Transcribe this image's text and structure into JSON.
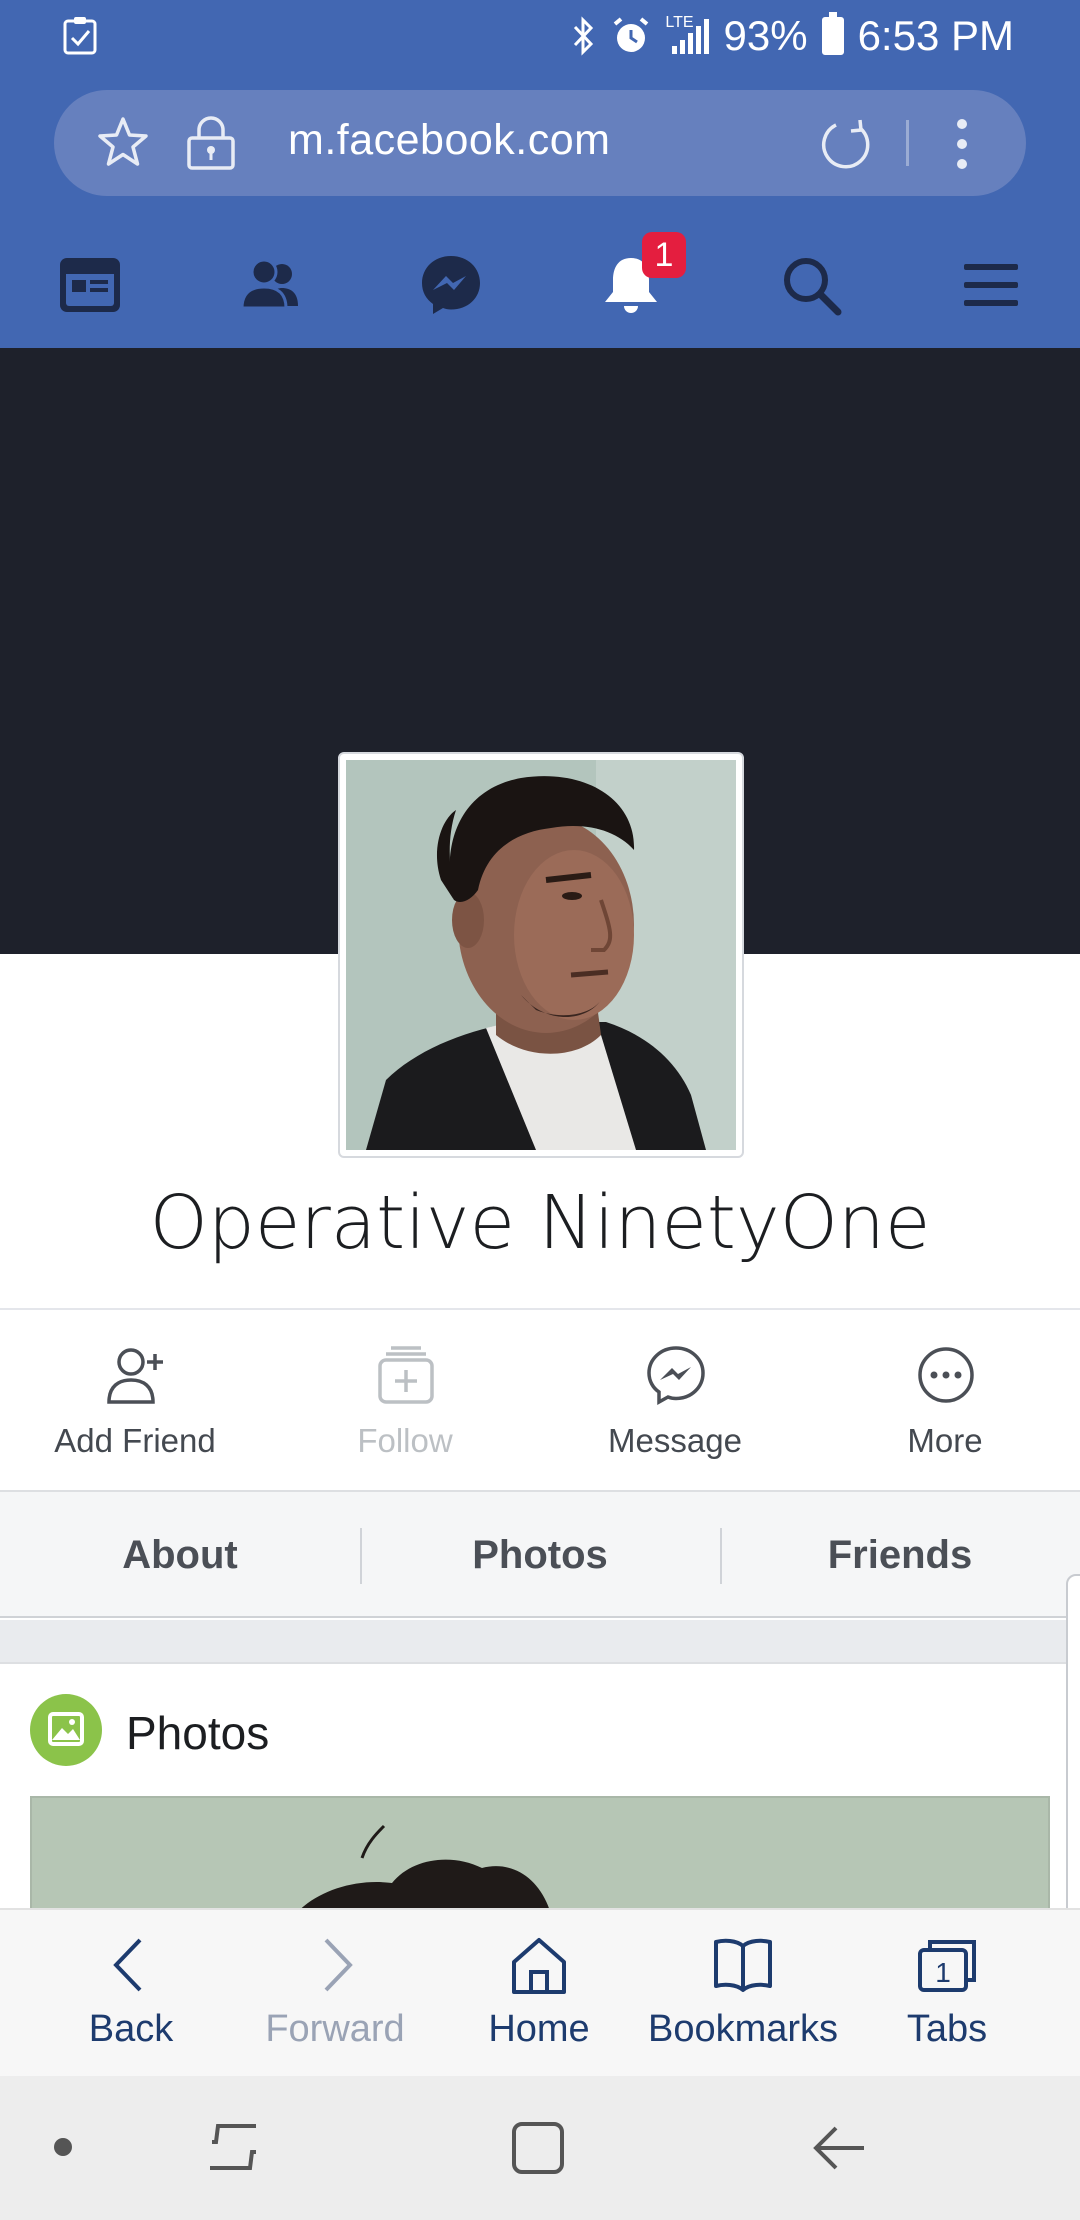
{
  "status_bar": {
    "network": "LTE",
    "battery": "93%",
    "time": "6:53 PM"
  },
  "browser": {
    "url": "m.facebook.com"
  },
  "fb_nav": {
    "notification_count": "1",
    "items": [
      "news-feed-icon",
      "friends-icon",
      "messenger-icon",
      "notifications-icon",
      "search-icon",
      "menu-icon"
    ]
  },
  "profile": {
    "name": "Operative NinetyOne"
  },
  "actions": {
    "add_friend": "Add Friend",
    "follow": "Follow",
    "message": "Message",
    "more": "More"
  },
  "tabs": {
    "about": "About",
    "photos": "Photos",
    "friends": "Friends"
  },
  "photos_section": {
    "title": "Photos"
  },
  "browser_bottom": {
    "back": "Back",
    "forward": "Forward",
    "home": "Home",
    "bookmarks": "Bookmarks",
    "tabs": "Tabs",
    "tab_count": "1"
  },
  "colors": {
    "brand": "#4267b2",
    "cover": "#1e212b",
    "badge": "#e41e3f",
    "photos_icon": "#8bc34a"
  }
}
